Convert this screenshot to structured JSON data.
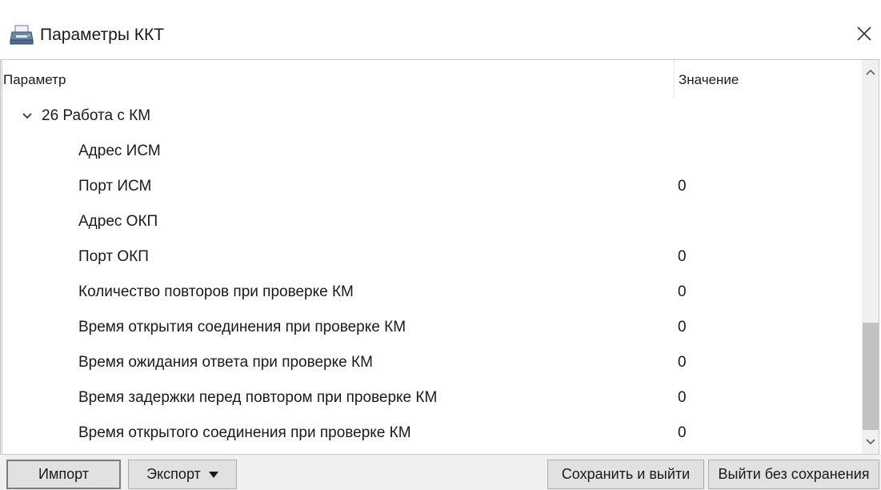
{
  "window": {
    "title": "Параметры ККТ",
    "icon": "printer-icon",
    "close_icon": "close-icon"
  },
  "grid": {
    "columns": {
      "parameter": "Параметр",
      "value": "Значение"
    },
    "group": {
      "label": "26 Работа с КМ",
      "expanded": true,
      "toggle_icon": "chevron-down-icon"
    },
    "rows": [
      {
        "label": "Адрес ИСМ",
        "value": ""
      },
      {
        "label": "Порт ИСМ",
        "value": "0"
      },
      {
        "label": "Адрес ОКП",
        "value": ""
      },
      {
        "label": "Порт ОКП",
        "value": "0"
      },
      {
        "label": "Количество повторов при проверке КМ",
        "value": "0"
      },
      {
        "label": "Время открытия соединения при проверке КМ",
        "value": "0"
      },
      {
        "label": "Время ожидания ответа при проверке КМ",
        "value": "0"
      },
      {
        "label": "Время задержки перед повтором при проверке КМ",
        "value": "0"
      },
      {
        "label": "Время открытого соединения при проверке КМ",
        "value": "0"
      }
    ],
    "scrollbar": {
      "up_icon": "chevron-up-icon",
      "down_icon": "chevron-down-icon",
      "thumb_position_fraction": 0.69,
      "thumb_size_fraction": 0.31
    }
  },
  "footer": {
    "import_label": "Импорт",
    "export_label": "Экспорт",
    "save_exit_label": "Сохранить и выйти",
    "exit_nosave_label": "Выйти без сохранения"
  },
  "colors": {
    "window_bg": "#ffffff",
    "footer_bg": "#f0f0f0",
    "button_bg": "#e1e1e1",
    "scroll_thumb": "#c2c2c2"
  }
}
